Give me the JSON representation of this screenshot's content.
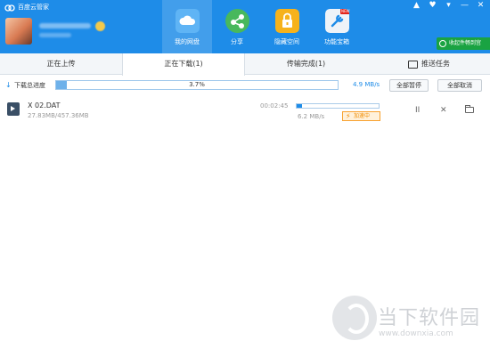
{
  "window": {
    "title": "百度云管家",
    "controls": [
      "▲",
      "♥",
      "▾",
      "—",
      "✕"
    ]
  },
  "nav": [
    {
      "label": "我的网盘",
      "icon": "cloud-icon",
      "color": "#5fb4f5",
      "active": true
    },
    {
      "label": "分享",
      "icon": "share-icon",
      "color": "#48b85c",
      "active": false
    },
    {
      "label": "隐藏空间",
      "icon": "lock-icon",
      "color": "#f6b21b",
      "active": false
    },
    {
      "label": "功能宝箱",
      "icon": "toolbox-icon",
      "color": "#eef3f8",
      "active": false,
      "badge": "NEW"
    }
  ],
  "complete_button": "收起件畅到宫",
  "tabs": [
    {
      "label": "正在上传",
      "active": false
    },
    {
      "label": "正在下载(1)",
      "active": true
    },
    {
      "label": "传输完成(1)",
      "active": false
    }
  ],
  "push_tab": "推送任务",
  "summary": {
    "label": "下载总进度",
    "progress_text": "3.7%",
    "progress": 0.037,
    "speed": "4.9 MB/s",
    "pause_all": "全部暂停",
    "cancel_all": "全部取消"
  },
  "task": {
    "name": "X 02.DAT",
    "size": "27.83MB/457.36MB",
    "time_left": "00:02:45",
    "progress": 0.061,
    "speed": "6.2 MB/s",
    "accel": "加速中",
    "pause_symbol": "II",
    "close_symbol": "✕"
  },
  "watermark": {
    "title": "当下软件园",
    "url": "www.downxia.com"
  },
  "colors": {
    "header": "#1e8ce8",
    "accent": "#1e8ce8",
    "accel": "#f08c00",
    "complete": "#1aa342"
  }
}
